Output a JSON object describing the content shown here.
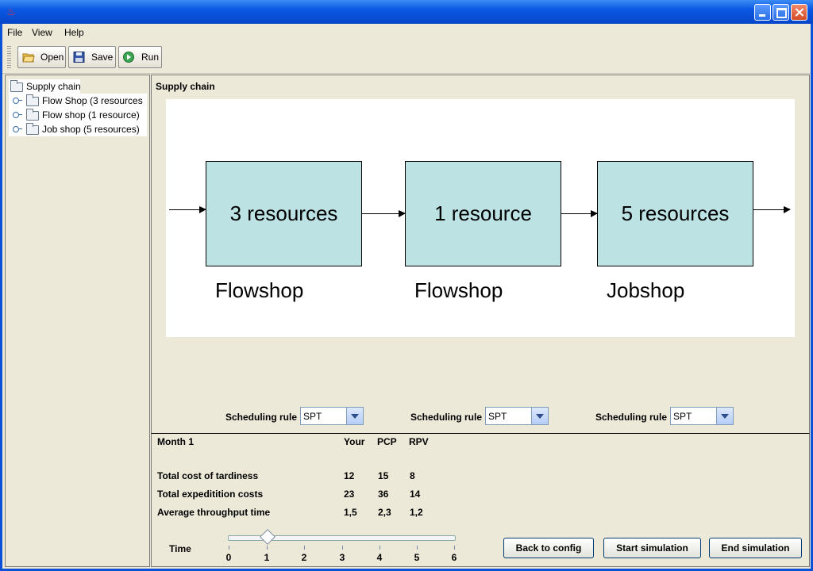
{
  "window": {
    "colors": {
      "titlebar": "#0a58e3",
      "frame": "#ece9d8",
      "box": "#bde2e4"
    }
  },
  "menu": {
    "file": "File",
    "view": "View",
    "help": "Help"
  },
  "toolbar": {
    "open": "Open",
    "save": "Save",
    "run": "Run"
  },
  "tree": {
    "root": "Supply chain",
    "items": [
      {
        "label": "Flow Shop (3 resources"
      },
      {
        "label": "Flow shop (1 resource)"
      },
      {
        "label": "Job shop (5 resources)"
      }
    ]
  },
  "main": {
    "title": "Supply chain",
    "stages": [
      {
        "box": "3 resources",
        "caption": "Flowshop"
      },
      {
        "box": "1 resource",
        "caption": "Flowshop"
      },
      {
        "box": "5 resources",
        "caption": "Jobshop"
      }
    ],
    "scheduling": [
      {
        "label": "Scheduling rule",
        "value": "SPT"
      },
      {
        "label": "Scheduling rule",
        "value": "SPT"
      },
      {
        "label": "Scheduling rule",
        "value": "SPT"
      }
    ]
  },
  "stats": {
    "month": "Month 1",
    "headers": [
      "Your",
      "PCP",
      "RPV"
    ],
    "rows": [
      {
        "label": "Total cost of tardiness",
        "values": [
          "12",
          "15",
          "8"
        ]
      },
      {
        "label": "Total expeditition costs",
        "values": [
          "23",
          "36",
          "14"
        ]
      },
      {
        "label": "Average throughput time",
        "values": [
          "1,5",
          "2,3",
          "1,2"
        ]
      }
    ]
  },
  "time": {
    "label": "Time",
    "ticks": [
      "0",
      "1",
      "2",
      "3",
      "4",
      "5",
      "6"
    ],
    "value": 1
  },
  "actions": {
    "back": "Back to config",
    "start": "Start simulation",
    "end": "End simulation"
  }
}
